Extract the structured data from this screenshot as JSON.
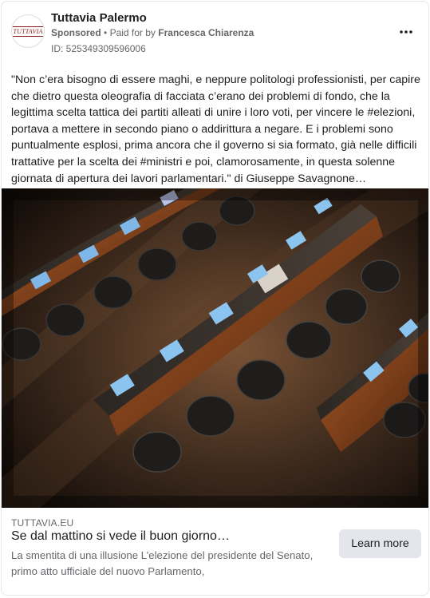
{
  "post": {
    "page_name": "Tuttavia Palermo",
    "avatar_text": "TUTTAVIA",
    "sponsored_label": "Sponsored",
    "separator": "•",
    "paid_for_prefix": "Paid for by",
    "payer_name": "Francesca Chiarenza",
    "ad_id": "ID: 525349309596006",
    "more_icon": "more-horizontal-icon",
    "body": "\"Non c’era bisogno di essere maghi, e neppure politologi professionisti, per capire che dietro questa oleografia di facciata c’erano dei problemi di fondo, che la legittima scelta tattica dei partiti alleati di unire i loro voti, per vincere le #elezioni, portava a mettere in secondo piano o addirittura a negare. E i problemi sono puntualmente esplosi, prima ancora che il governo si sia formato, già nelle difficili trattative per la scelta dei #ministri e poi, clamorosamente, in questa solenne giornata di apertura dei lavori parlamentari.\" di Giuseppe Savagnone…"
  },
  "link": {
    "domain": "TUTTAVIA.EU",
    "headline": "Se dal mattino si vede il buon giorno…",
    "description": "La smentita di una illusione L’elezione del presidente del Senato, primo atto ufficiale del nuovo Parlamento,",
    "cta_label": "Learn more"
  },
  "colors": {
    "text_primary": "#1c1e21",
    "text_secondary": "#65676b",
    "cta_background": "#e4e6eb",
    "wood": "#8a4a22",
    "screen_blue": "#7fb8e8"
  }
}
